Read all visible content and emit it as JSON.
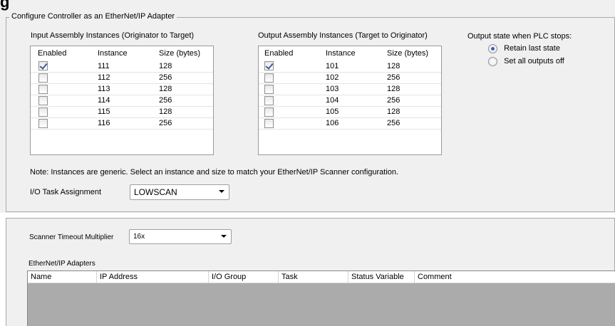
{
  "page_title": "g",
  "adapter_group": {
    "legend": "Configure Controller as an EtherNet/IP Adapter",
    "input_assembly": {
      "label": "Input Assembly Instances (Originator to Target)",
      "columns": [
        "Enabled",
        "Instance",
        "Size (bytes)"
      ],
      "rows": [
        {
          "enabled": true,
          "instance": "111",
          "size": "128"
        },
        {
          "enabled": false,
          "instance": "112",
          "size": "256"
        },
        {
          "enabled": false,
          "instance": "113",
          "size": "128"
        },
        {
          "enabled": false,
          "instance": "114",
          "size": "256"
        },
        {
          "enabled": false,
          "instance": "115",
          "size": "128"
        },
        {
          "enabled": false,
          "instance": "116",
          "size": "256"
        }
      ]
    },
    "output_assembly": {
      "label": "Output Assembly Instances (Target to Originator)",
      "columns": [
        "Enabled",
        "Instance",
        "Size (bytes)"
      ],
      "rows": [
        {
          "enabled": true,
          "instance": "101",
          "size": "128"
        },
        {
          "enabled": false,
          "instance": "102",
          "size": "256"
        },
        {
          "enabled": false,
          "instance": "103",
          "size": "128"
        },
        {
          "enabled": false,
          "instance": "104",
          "size": "256"
        },
        {
          "enabled": false,
          "instance": "105",
          "size": "128"
        },
        {
          "enabled": false,
          "instance": "106",
          "size": "256"
        }
      ]
    },
    "output_state": {
      "label": "Output state when PLC stops:",
      "options": [
        {
          "label": "Retain last state",
          "selected": true
        },
        {
          "label": "Set all outputs off",
          "selected": false
        }
      ]
    },
    "note": "Note: Instances are generic.  Select an instance and size to match your EtherNet/IP Scanner configuration.",
    "io_task": {
      "label": "I/O Task Assignment",
      "value": "LOWSCAN"
    }
  },
  "scanner": {
    "timeout_label": "Scanner Timeout Multiplier",
    "timeout_value": "16x",
    "adapters_label": "EtherNet/IP Adapters",
    "columns": [
      "Name",
      "IP Address",
      "I/O Group",
      "Task",
      "Status Variable",
      "Comment"
    ]
  },
  "colors": {
    "panel_bg": "#f0f0f0",
    "list_empty_bg": "#ababab",
    "radio_dot": "#2d64c0",
    "check": "#3b5b9b"
  }
}
